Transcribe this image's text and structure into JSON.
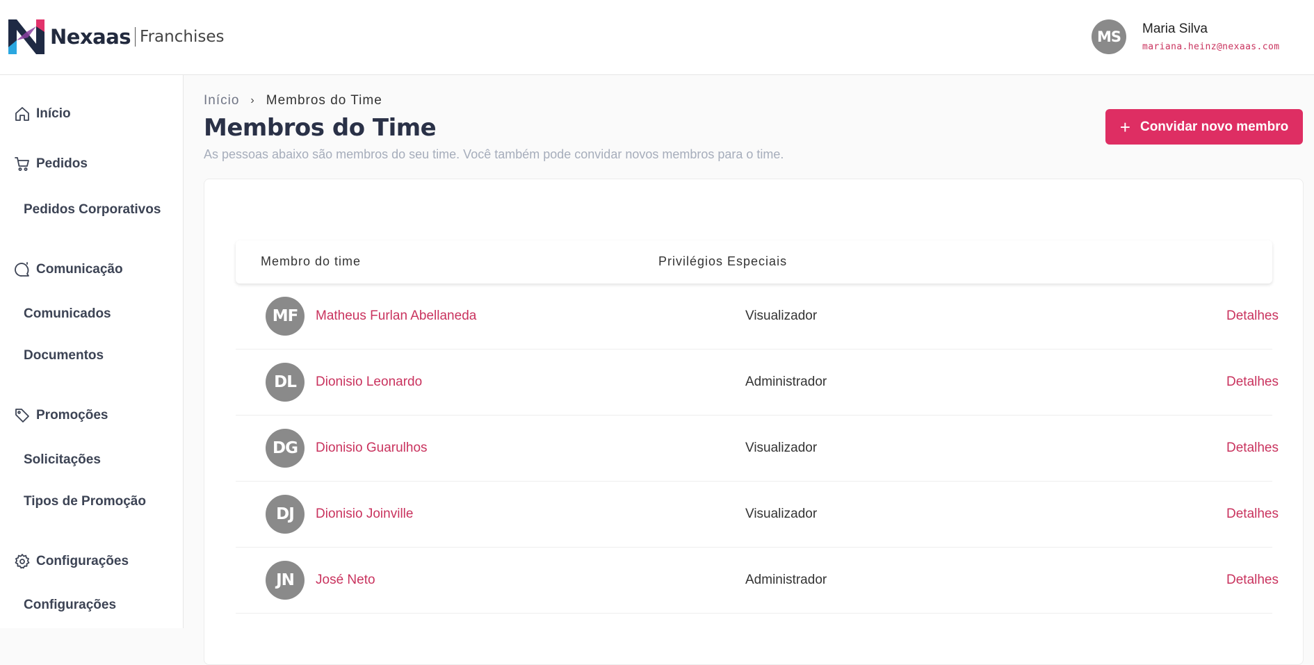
{
  "header": {
    "brand": "Nexaas",
    "brand_sub": "Franchises",
    "user": {
      "initials": "MS",
      "name": "Maria Silva",
      "email": "mariana.heinz@nexaas.com"
    }
  },
  "sidebar": {
    "groups": [
      {
        "label": "Início",
        "icon": "home-icon"
      },
      {
        "label": "Pedidos",
        "icon": "cart-icon"
      },
      {
        "label": "Comunicação",
        "icon": "chat-icon"
      },
      {
        "label": "Promoções",
        "icon": "tag-icon"
      },
      {
        "label": "Configurações",
        "icon": "gear-icon"
      }
    ],
    "items": [
      {
        "label": "Pedidos Corporativos"
      },
      {
        "label": "Comunicados"
      },
      {
        "label": "Documentos"
      },
      {
        "label": "Solicitações"
      },
      {
        "label": "Tipos de Promoção"
      },
      {
        "label": "Configurações"
      }
    ]
  },
  "breadcrumb": {
    "home": "Início",
    "separator": "›",
    "current": "Membros do Time"
  },
  "page": {
    "title": "Membros do Time",
    "description": "As pessoas abaixo são membros do seu time. Você também pode convidar novos membros para o time.",
    "invite_button": "Convidar novo membro",
    "invite_icon": "+"
  },
  "table": {
    "columns": [
      "Membro do time",
      "Privilégios Especiais"
    ],
    "rows": [
      {
        "initials": "MF",
        "name": "Matheus Furlan Abellaneda",
        "role": "Visualizador",
        "action": "Detalhes"
      },
      {
        "initials": "DL",
        "name": "Dionisio Leonardo",
        "role": "Administrador",
        "action": "Detalhes"
      },
      {
        "initials": "DG",
        "name": "Dionisio Guarulhos",
        "role": "Visualizador",
        "action": "Detalhes"
      },
      {
        "initials": "DJ",
        "name": "Dionisio Joinville",
        "role": "Visualizador",
        "action": "Detalhes"
      },
      {
        "initials": "JN",
        "name": "José Neto",
        "role": "Administrador",
        "action": "Detalhes"
      }
    ]
  },
  "colors": {
    "accent": "#de2e63",
    "link": "#c9335e",
    "avatar": "#8a8a8a",
    "title": "#2a3147"
  }
}
